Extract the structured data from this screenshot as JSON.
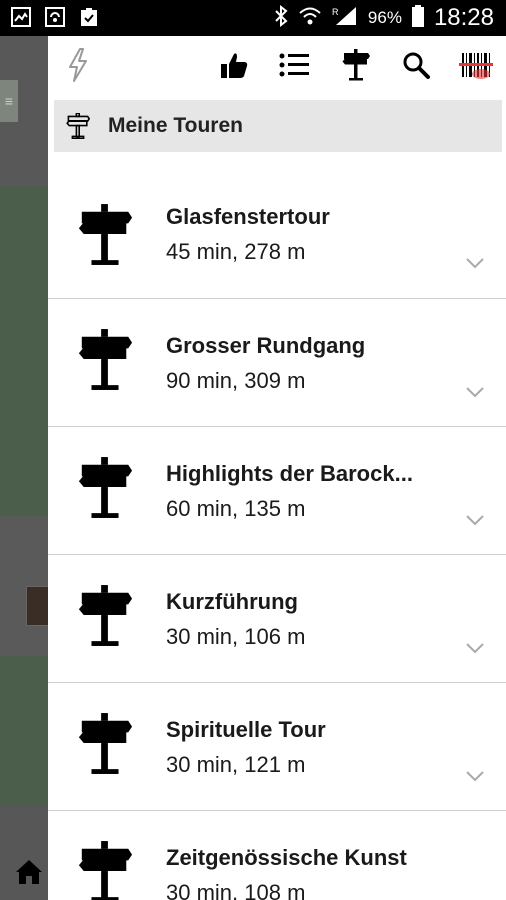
{
  "statusbar": {
    "battery_percent": "96%",
    "time": "18:28",
    "left_icons": [
      "gallery-icon",
      "sync-icon",
      "clipboard-icon"
    ],
    "right_icons": [
      "bluetooth-icon",
      "wifi-icon",
      "signal-icon",
      "battery-icon"
    ]
  },
  "toolbar": {
    "icons": [
      "flash-icon",
      "thumbs-up-icon",
      "list-icon",
      "signpost-icon",
      "search-icon",
      "barcode-scanner-icon"
    ]
  },
  "section": {
    "title": "Meine Touren",
    "icon": "signpost-icon"
  },
  "tours": [
    {
      "name": "Glasfenstertour",
      "meta": "45 min, 278 m"
    },
    {
      "name": "Grosser Rundgang",
      "meta": "90 min, 309 m"
    },
    {
      "name": "Highlights der Barock...",
      "meta": "60 min, 135 m"
    },
    {
      "name": "Kurzführung",
      "meta": "30 min, 106 m"
    },
    {
      "name": "Spirituelle Tour",
      "meta": "30 min, 121 m"
    },
    {
      "name": "Zeitgenössische Kunst",
      "meta": "30 min, 108 m"
    }
  ],
  "colors": {
    "statusbar_bg": "#000000",
    "header_bg": "#e6e6e6",
    "map_green": "#4f5f4f",
    "scanner_red": "#e53935"
  }
}
